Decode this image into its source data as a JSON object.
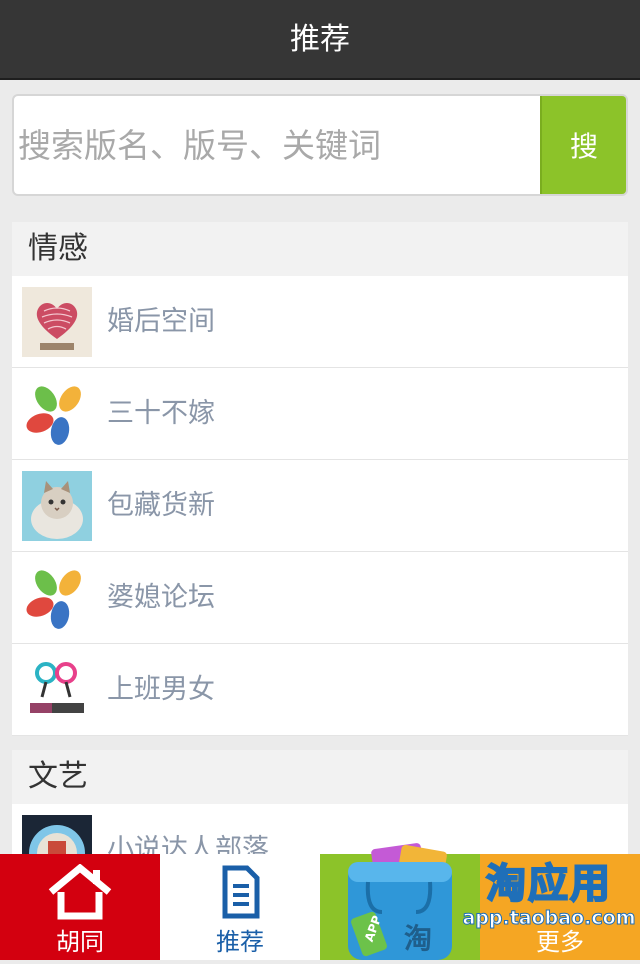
{
  "header": {
    "title": "推荐"
  },
  "search": {
    "placeholder": "搜索版名、版号、关键词",
    "button_label": "搜"
  },
  "sections": [
    {
      "title": "情感",
      "items": [
        {
          "label": "婚后空间",
          "icon": "heart-fingerprint-logo"
        },
        {
          "label": "三十不嫁",
          "icon": "petal-logo"
        },
        {
          "label": "包藏货新",
          "icon": "cat-photo"
        },
        {
          "label": "婆媳论坛",
          "icon": "petal-logo"
        },
        {
          "label": "上班男女",
          "icon": "couple-logo"
        }
      ]
    },
    {
      "title": "文艺",
      "items": [
        {
          "label": "小说达人部落",
          "icon": "circle-badge-logo"
        }
      ]
    }
  ],
  "tabbar": {
    "tabs": [
      {
        "label": "胡同",
        "icon": "home-icon",
        "bg": "#d3000f"
      },
      {
        "label": "推荐",
        "icon": "document-icon",
        "bg": "#ffffff"
      },
      {
        "label": "",
        "icon": "app-bag-icon",
        "bg": "#8cc329"
      },
      {
        "label": "更多",
        "icon": "more-icon",
        "bg": "#f5a623"
      }
    ]
  },
  "watermark": {
    "brand": "淘应用",
    "url": "app.taobao.com",
    "bag_text_1": "APP",
    "bag_text_2": "淘"
  },
  "colors": {
    "header_bg": "#363636",
    "accent_green": "#8cc329",
    "tab_red": "#d3000f",
    "tab_orange": "#f5a623",
    "label_gray": "#8a96a8"
  }
}
